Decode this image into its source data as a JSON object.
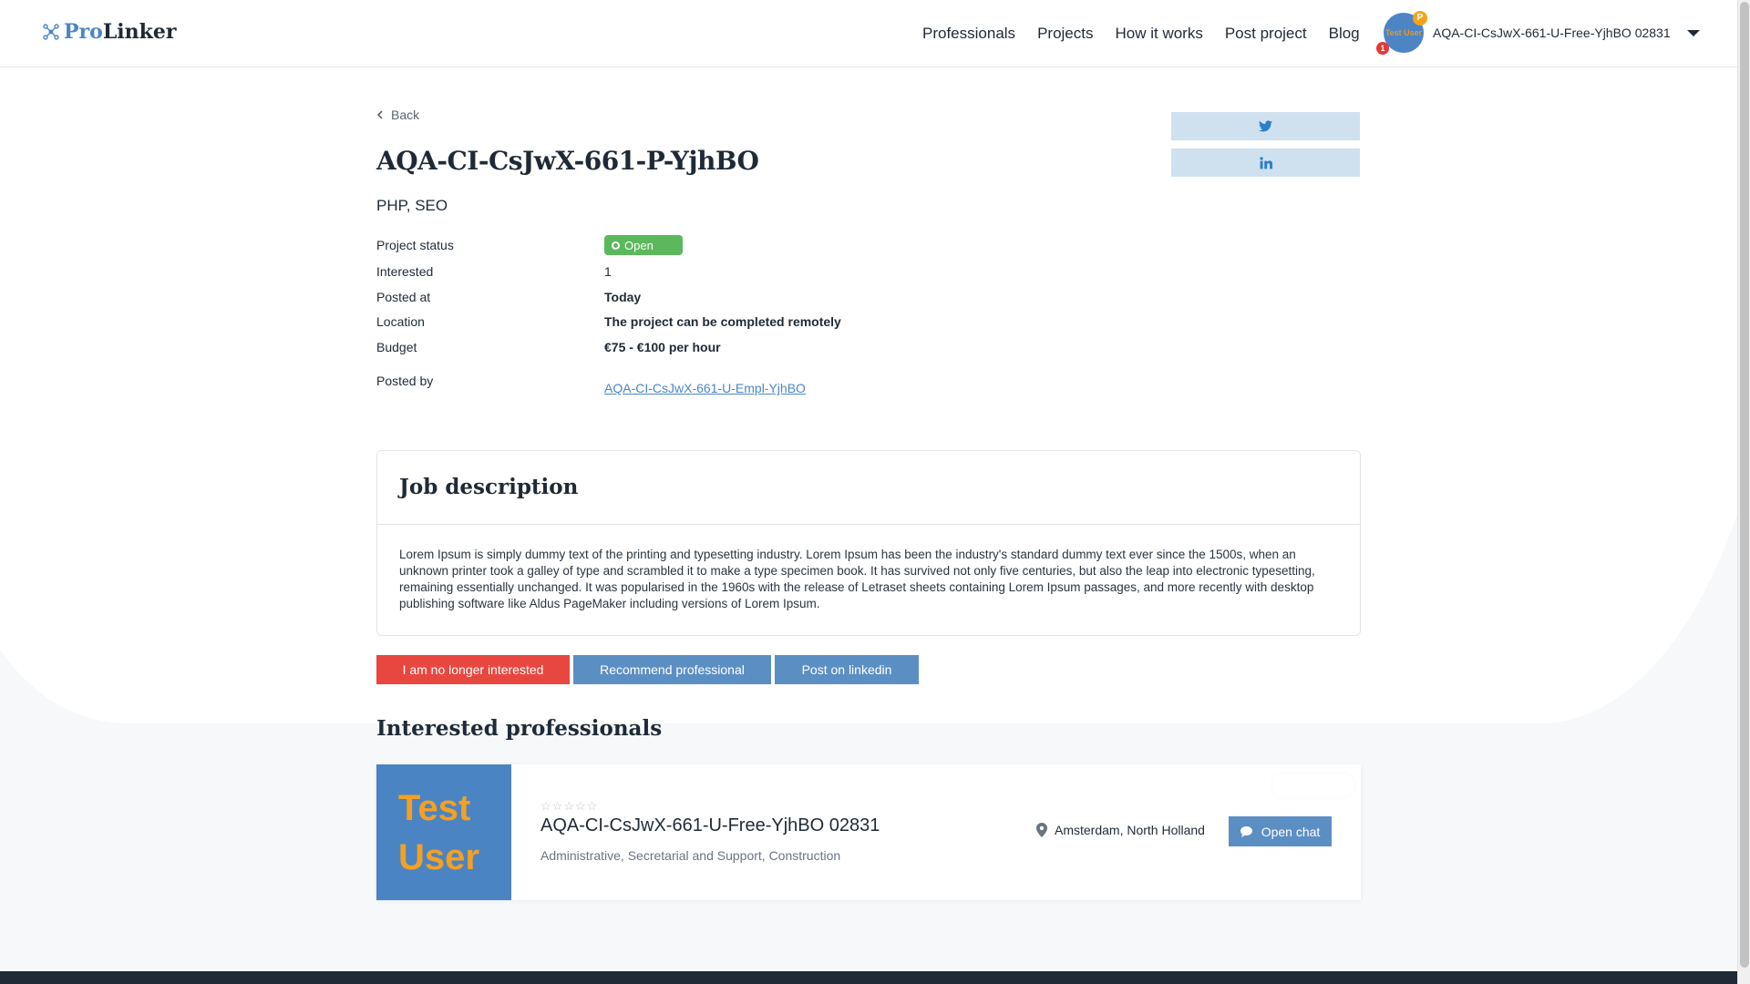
{
  "header": {
    "logo_pro": "Pro",
    "logo_linker": "Linker",
    "nav": [
      "Professionals",
      "Projects",
      "How it works",
      "Post project",
      "Blog"
    ],
    "user": {
      "avatar_text": "Test User",
      "badge_p": "P",
      "notifications": "1",
      "name": "AQA-CI-CsJwX-661-U-Free-YjhBO 02831"
    }
  },
  "project": {
    "back_label": "Back",
    "title": "AQA-CI-CsJwX-661-P-YjhBO",
    "skills": "PHP, SEO",
    "share": {
      "twitter_icon": "twitter-icon",
      "linkedin_icon": "linkedin-icon"
    },
    "details": {
      "status_label": "Project status",
      "status_value": "Open",
      "interested_label": "Interested",
      "interested_value": "1",
      "posted_at_label": "Posted at",
      "posted_at_value": "Today",
      "location_label": "Location",
      "location_value": "The project can be completed remotely",
      "budget_label": "Budget",
      "budget_value": "€75 - €100 per hour",
      "posted_by_label": "Posted by",
      "posted_by_value": "AQA-CI-CsJwX-661-U-Empl-YjhBO"
    },
    "description": {
      "heading": "Job description",
      "text": "Lorem Ipsum is simply dummy text of the printing and typesetting industry. Lorem Ipsum has been the industry's standard dummy text ever since the 1500s, when an unknown printer took a galley of type and scrambled it to make a type specimen book. It has survived not only five centuries, but also the leap into electronic typesetting, remaining essentially unchanged. It was popularised in the 1960s with the release of Letraset sheets containing Lorem Ipsum passages, and more recently with desktop publishing software like Aldus PageMaker including versions of Lorem Ipsum."
    },
    "actions": {
      "not_interested": "I am no longer interested",
      "recommend": "Recommend professional",
      "post_linkedin": "Post on linkedin"
    },
    "colors": {
      "open": "#5cb85c",
      "danger": "#e8473f",
      "primary": "#5b8fc4"
    }
  },
  "interested": {
    "heading": "Interested professionals",
    "professionals": [
      {
        "photo_line1": "Test",
        "photo_line2": "User",
        "rating": 0,
        "name": "AQA-CI-CsJwX-661-U-Free-YjhBO 02831",
        "categories": "Administrative, Secretarial and Support, Construction",
        "location": "Amsterdam, North Holland",
        "chat_label": "Open chat"
      }
    ]
  }
}
